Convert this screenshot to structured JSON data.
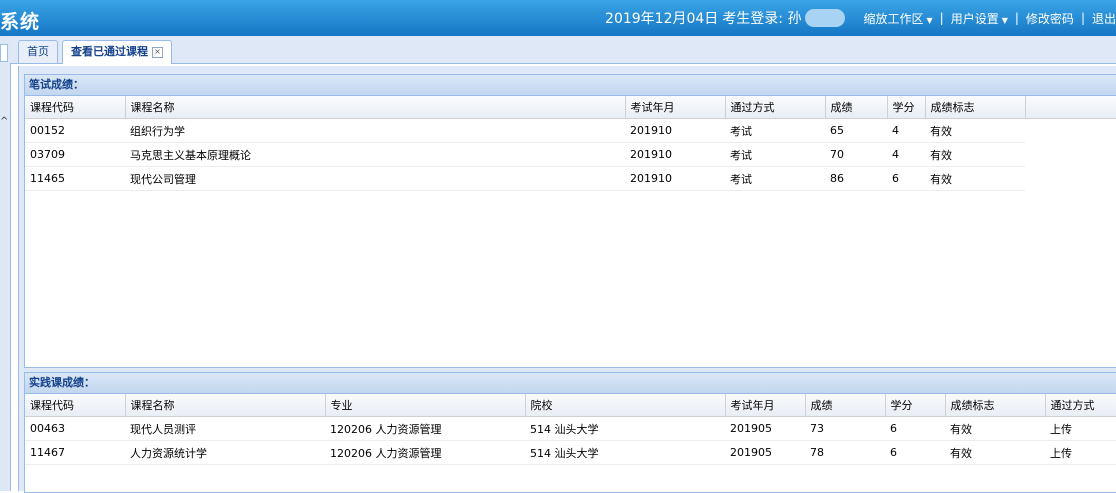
{
  "header": {
    "system_title": "系统",
    "date": "2019年12月04日",
    "login_label": "考生登录: 孙",
    "menu": [
      {
        "label": "缩放工作区",
        "dropdown": true
      },
      {
        "label": "用户设置",
        "dropdown": true
      },
      {
        "label": "修改密码",
        "dropdown": false
      },
      {
        "label": "退出",
        "dropdown": false
      }
    ]
  },
  "tabs": [
    {
      "label": "首页",
      "active": false
    },
    {
      "label": "查看已通过课程",
      "active": true,
      "closable": true
    }
  ],
  "written": {
    "title": "笔试成绩：",
    "columns": [
      "课程代码",
      "课程名称",
      "考试年月",
      "通过方式",
      "成绩",
      "学分",
      "成绩标志"
    ],
    "rows": [
      [
        "00152",
        "组织行为学",
        "201910",
        "考试",
        "65",
        "4",
        "有效"
      ],
      [
        "03709",
        "马克思主义基本原理概论",
        "201910",
        "考试",
        "70",
        "4",
        "有效"
      ],
      [
        "11465",
        "现代公司管理",
        "201910",
        "考试",
        "86",
        "6",
        "有效"
      ]
    ]
  },
  "practice": {
    "title": "实践课成绩：",
    "columns": [
      "课程代码",
      "课程名称",
      "专业",
      "院校",
      "考试年月",
      "成绩",
      "学分",
      "成绩标志",
      "通过方式"
    ],
    "rows": [
      [
        "00463",
        "现代人员测评",
        "120206 人力资源管理",
        "514 汕头大学",
        "201905",
        "73",
        "6",
        "有效",
        "上传"
      ],
      [
        "11467",
        "人力资源统计学",
        "120206 人力资源管理",
        "514 汕头大学",
        "201905",
        "78",
        "6",
        "有效",
        "上传"
      ]
    ]
  }
}
